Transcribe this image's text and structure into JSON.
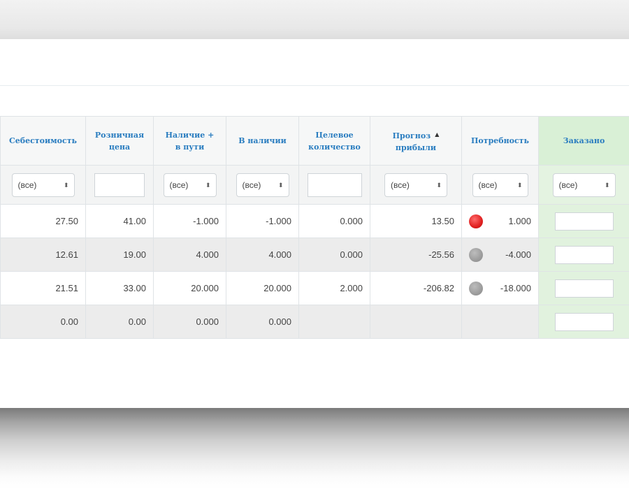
{
  "table": {
    "headers": {
      "cost": "Себестоимость",
      "retail_l1": "Розничная",
      "retail_l2": "цена",
      "avail_transit_l1": "Наличие +",
      "avail_transit_l2": "в пути",
      "in_stock": "В наличии",
      "target_l1": "Целевое",
      "target_l2": "количество",
      "profit_l1": "Прогноз",
      "profit_l2": "прибыли",
      "profit_sort_icon": "▲",
      "need": "Потребность",
      "ordered": "Заказано"
    },
    "filters": {
      "cost": "(все)",
      "avail_transit": "(все)",
      "in_stock": "(все)",
      "profit": "(все)",
      "need": "(все)",
      "ordered": "(все)",
      "select_arrows": "⬍"
    },
    "rows": [
      {
        "cost": "27.50",
        "retail": "41.00",
        "avail_transit": "-1.000",
        "in_stock": "-1.000",
        "target": "0.000",
        "profit": "13.50",
        "need": "1.000",
        "status": "red"
      },
      {
        "cost": "12.61",
        "retail": "19.00",
        "avail_transit": "4.000",
        "in_stock": "4.000",
        "target": "0.000",
        "profit": "-25.56",
        "need": "-4.000",
        "status": "grey"
      },
      {
        "cost": "21.51",
        "retail": "33.00",
        "avail_transit": "20.000",
        "in_stock": "20.000",
        "target": "2.000",
        "profit": "-206.82",
        "need": "-18.000",
        "status": "grey"
      },
      {
        "cost": "0.00",
        "retail": "0.00",
        "avail_transit": "0.000",
        "in_stock": "0.000",
        "target": "",
        "profit": "",
        "need": "",
        "status": ""
      }
    ]
  },
  "colors": {
    "header_text": "#2a7dc0",
    "ordered_column_bg": "#d9f0d6",
    "status_red": "#e02020",
    "status_grey": "#9a9a9a"
  }
}
